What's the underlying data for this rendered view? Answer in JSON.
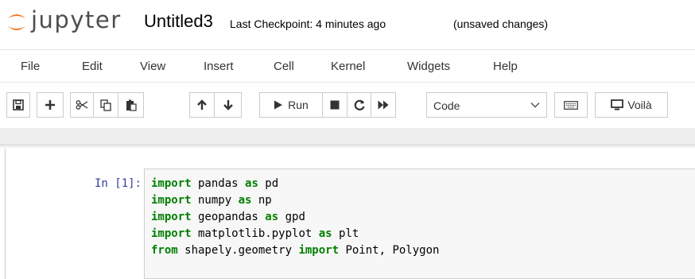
{
  "header": {
    "logo_text": "jupyter",
    "notebook_name": "Untitled3",
    "checkpoint": "Last Checkpoint: 4 minutes ago",
    "unsaved": "(unsaved changes)"
  },
  "menu": [
    "File",
    "Edit",
    "View",
    "Insert",
    "Cell",
    "Kernel",
    "Widgets",
    "Help"
  ],
  "toolbar": {
    "run_label": "Run",
    "cell_type": "Code",
    "voila_label": "Voilà",
    "icons": [
      "save-icon",
      "plus-icon",
      "cut-icon",
      "copy-icon",
      "paste-icon",
      "arrow-up-icon",
      "arrow-down-icon",
      "run-icon",
      "stop-icon",
      "restart-icon",
      "fast-forward-icon",
      "keyboard-icon",
      "monitor-icon"
    ]
  },
  "cell": {
    "prompt": "In [1]:",
    "lines": [
      {
        "kw1": "import",
        "t1": " pandas ",
        "kw2": "as",
        "t2": " pd"
      },
      {
        "kw1": "import",
        "t1": " numpy ",
        "kw2": "as",
        "t2": " np"
      },
      {
        "kw1": "import",
        "t1": " geopandas ",
        "kw2": "as",
        "t2": " gpd"
      },
      {
        "kw1": "import",
        "t1": " matplotlib.pyplot ",
        "kw2": "as",
        "t2": " plt"
      },
      {
        "kw1": "from",
        "t1": " shapely.geometry ",
        "kw2": "import",
        "t2": " Point, Polygon"
      }
    ]
  },
  "colors": {
    "keyword": "#008000",
    "prompt": "#303f9f",
    "logo_orange": "#f37726"
  }
}
